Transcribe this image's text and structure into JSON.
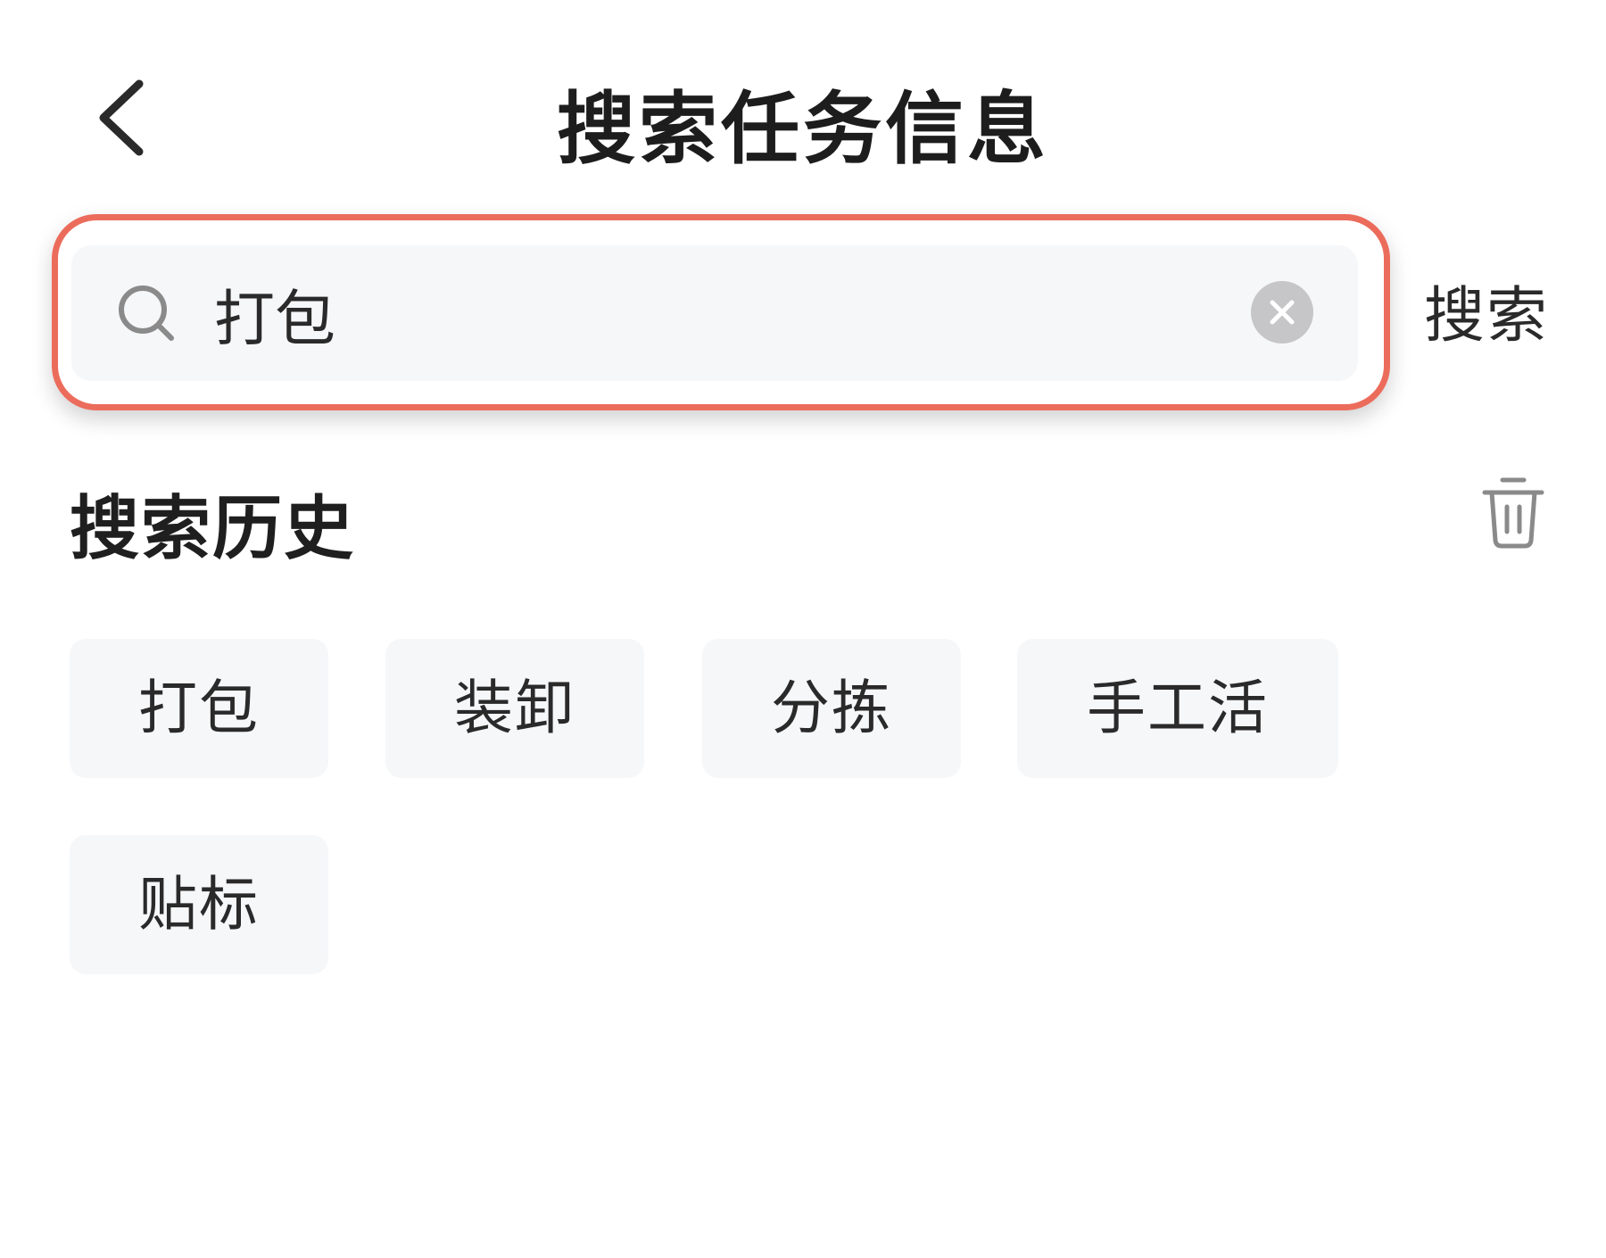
{
  "header": {
    "title": "搜索任务信息"
  },
  "search": {
    "value": "打包",
    "submit_label": "搜索"
  },
  "history": {
    "title": "搜索历史",
    "items": [
      "打包",
      "装卸",
      "分拣",
      "手工活",
      "贴标"
    ]
  },
  "icons": {
    "back": "chevron-left-icon",
    "search": "search-icon",
    "clear": "clear-circle-icon",
    "delete": "trash-icon"
  },
  "colors": {
    "highlight_border": "#ec6c5c",
    "input_background": "#f6f7f9",
    "chip_background": "#f6f7f9",
    "clear_icon": "#c6c6c9",
    "icon_gray": "#8a8a8a"
  }
}
